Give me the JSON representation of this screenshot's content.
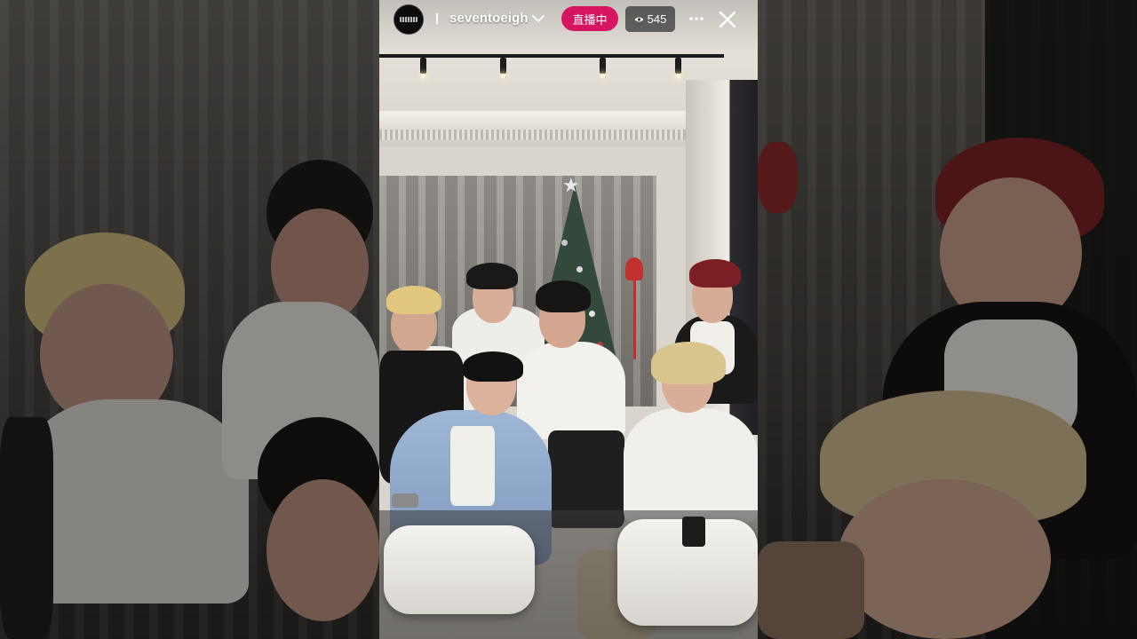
{
  "live_header": {
    "avatar_icon": "brand-logo-avatar",
    "prefix": "I",
    "username": "seventoeigh",
    "live_label": "直播中",
    "viewer_count": "545",
    "viewer_icon": "eye-icon",
    "more_icon": "more-horizontal-icon",
    "close_icon": "close-icon"
  },
  "colors": {
    "live_badge": "#d7145f",
    "viewer_badge": "#3c3c3c"
  }
}
